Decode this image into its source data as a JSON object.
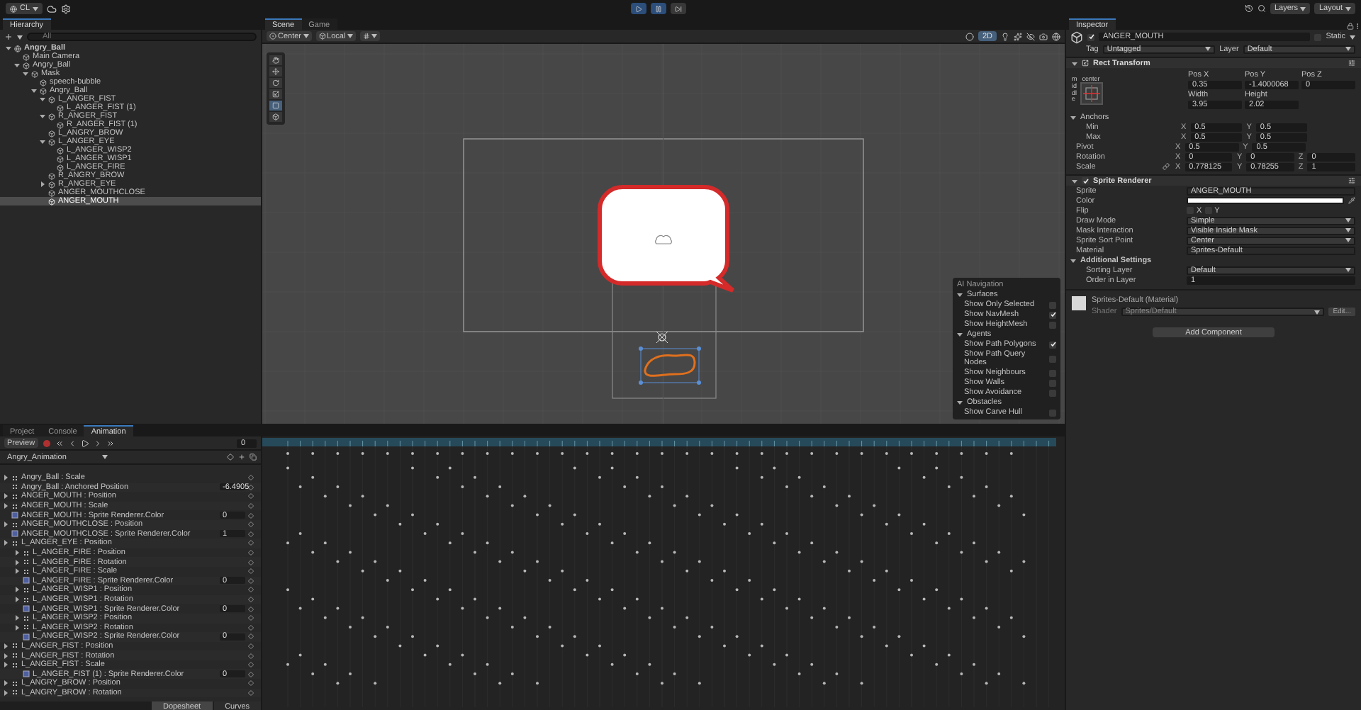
{
  "top_bar": {
    "account": "CL",
    "layers": "Layers",
    "layout": "Layout"
  },
  "hierarchy": {
    "tab": "Hierarchy",
    "search_placeholder": "All",
    "tree": [
      {
        "label": "Angry_Ball",
        "kind": "scene",
        "selected": false,
        "expanded": true,
        "children": [
          {
            "label": "Main Camera",
            "kind": "object",
            "selected": false
          },
          {
            "label": "Angry_Ball",
            "kind": "object",
            "selected": false,
            "expanded": true,
            "children": [
              {
                "label": "Mask",
                "kind": "object",
                "selected": false,
                "expanded": true,
                "children": [
                  {
                    "label": "speech-bubble",
                    "kind": "object",
                    "selected": false
                  },
                  {
                    "label": "Angry_Ball",
                    "kind": "object",
                    "selected": false,
                    "expanded": true,
                    "children": [
                      {
                        "label": "L_ANGER_FIST",
                        "kind": "object",
                        "selected": false,
                        "expanded": true,
                        "children": [
                          {
                            "label": "L_ANGER_FIST (1)",
                            "kind": "object",
                            "selected": false
                          }
                        ]
                      },
                      {
                        "label": "R_ANGER_FIST",
                        "kind": "object",
                        "selected": false,
                        "expanded": true,
                        "children": [
                          {
                            "label": "R_ANGER_FIST (1)",
                            "kind": "object",
                            "selected": false
                          }
                        ]
                      },
                      {
                        "label": "L_ANGRY_BROW",
                        "kind": "object",
                        "selected": false
                      },
                      {
                        "label": "L_ANGER_EYE",
                        "kind": "object",
                        "selected": false,
                        "expanded": true,
                        "children": [
                          {
                            "label": "L_ANGER_WISP2",
                            "kind": "object",
                            "selected": false
                          },
                          {
                            "label": "L_ANGER_WISP1",
                            "kind": "object",
                            "selected": false
                          },
                          {
                            "label": "L_ANGER_FIRE",
                            "kind": "object",
                            "selected": false
                          }
                        ]
                      },
                      {
                        "label": "R_ANGRY_BROW",
                        "kind": "object",
                        "selected": false
                      },
                      {
                        "label": "R_ANGER_EYE",
                        "kind": "object",
                        "selected": false,
                        "expanded": false
                      },
                      {
                        "label": "ANGER_MOUTHCLOSE",
                        "kind": "object",
                        "selected": false
                      },
                      {
                        "label": "ANGER_MOUTH",
                        "kind": "object",
                        "selected": true
                      }
                    ]
                  }
                ]
              }
            ]
          }
        ]
      }
    ]
  },
  "scene": {
    "tabs": [
      {
        "label": "Scene",
        "selected": true
      },
      {
        "label": "Game",
        "selected": false
      }
    ],
    "pivot": "Center",
    "space": "Local",
    "mode_2d": {
      "label": "2D",
      "on": true
    },
    "ai_navigation": {
      "title": "AI Navigation",
      "sections": [
        {
          "label": "Surfaces",
          "expanded": true,
          "items": [
            {
              "label": "Show Only Selected",
              "checked": false
            },
            {
              "label": "Show NavMesh",
              "checked": true
            },
            {
              "label": "Show HeightMesh",
              "checked": false
            }
          ]
        },
        {
          "label": "Agents",
          "expanded": true,
          "items": [
            {
              "label": "Show Path Polygons",
              "checked": true
            },
            {
              "label": "Show Path Query Nodes",
              "checked": false
            },
            {
              "label": "Show Neighbours",
              "checked": false
            },
            {
              "label": "Show Walls",
              "checked": false
            },
            {
              "label": "Show Avoidance",
              "checked": false
            }
          ]
        },
        {
          "label": "Obstacles",
          "expanded": true,
          "items": [
            {
              "label": "Show Carve Hull",
              "checked": false
            }
          ]
        }
      ]
    }
  },
  "inspector": {
    "tab": "Inspector",
    "object_name": "ANGER_MOUTH",
    "active": true,
    "static": false,
    "static_label": "Static",
    "tag_label": "Tag",
    "tag": "Untagged",
    "layer_label": "Layer",
    "layer": "Default",
    "rect_transform": {
      "title": "Rect Transform",
      "anchor_top": "center",
      "anchor_side": "middle",
      "fields": [
        {
          "label": "Pos X",
          "value": "0.35"
        },
        {
          "label": "Pos Y",
          "value": "-1.4000068"
        },
        {
          "label": "Pos Z",
          "value": "0"
        },
        {
          "label": "Width",
          "value": "3.95"
        },
        {
          "label": "Height",
          "value": "2.02"
        }
      ],
      "anchors": {
        "label": "Anchors",
        "expanded": true,
        "children": [
          {
            "label": "Min",
            "axes": [
              {
                "axis": "X",
                "value": "0.5"
              },
              {
                "axis": "Y",
                "value": "0.5"
              }
            ]
          },
          {
            "label": "Max",
            "axes": [
              {
                "axis": "X",
                "value": "0.5"
              },
              {
                "axis": "Y",
                "value": "0.5"
              }
            ]
          }
        ]
      },
      "vectors": [
        {
          "label": "Pivot",
          "linked": false,
          "axes": [
            {
              "axis": "X",
              "value": "0.5"
            },
            {
              "axis": "Y",
              "value": "0.5"
            }
          ]
        },
        {
          "label": "Rotation",
          "linked": false,
          "axes": [
            {
              "axis": "X",
              "value": "0"
            },
            {
              "axis": "Y",
              "value": "0"
            },
            {
              "axis": "Z",
              "value": "0"
            }
          ]
        },
        {
          "label": "Scale",
          "linked": true,
          "axes": [
            {
              "axis": "X",
              "value": "0.778125"
            },
            {
              "axis": "Y",
              "value": "0.78255"
            },
            {
              "axis": "Z",
              "value": "1"
            }
          ]
        }
      ]
    },
    "sprite_renderer": {
      "title": "Sprite Renderer",
      "enabled": true,
      "fields": [
        {
          "label": "Sprite",
          "kind": "object",
          "value": "ANGER_MOUTH"
        },
        {
          "label": "Color",
          "kind": "color",
          "color": "#ffffff"
        },
        {
          "label": "Flip",
          "kind": "flip",
          "options": [
            {
              "label": "X",
              "checked": false
            },
            {
              "label": "Y",
              "checked": false
            }
          ]
        },
        {
          "label": "Draw Mode",
          "kind": "dropdown",
          "value": "Simple"
        },
        {
          "label": "Mask Interaction",
          "kind": "dropdown",
          "value": "Visible Inside Mask"
        },
        {
          "label": "Sprite Sort Point",
          "kind": "dropdown",
          "value": "Center"
        },
        {
          "label": "Material",
          "kind": "object",
          "value": "Sprites-Default"
        }
      ],
      "additional": {
        "label": "Additional Settings",
        "expanded": true,
        "fields": [
          {
            "label": "Sorting Layer",
            "kind": "dropdown",
            "value": "Default"
          },
          {
            "label": "Order in Layer",
            "kind": "number",
            "value": "1"
          }
        ]
      }
    },
    "material": {
      "name": "Sprites-Default (Material)",
      "shader_label": "Shader",
      "shader": "Sprites/Default",
      "edit": "Edit..."
    },
    "add_component": "Add Component"
  },
  "animation": {
    "tabs": [
      {
        "label": "Project",
        "selected": false
      },
      {
        "label": "Console",
        "selected": false
      },
      {
        "label": "Animation",
        "selected": true
      }
    ],
    "preview": "Preview",
    "recording": false,
    "frame": "0",
    "clip": "Angry_Animation",
    "rows": [
      {
        "label": "Angry_Ball : Scale",
        "kind": "transform",
        "expanded": false
      },
      {
        "label": "Angry_Ball : Anchored Position",
        "kind": "transform",
        "value": "-6.4905"
      },
      {
        "label": "ANGER_MOUTH : Position",
        "kind": "transform",
        "expanded": false
      },
      {
        "label": "ANGER_MOUTH : Scale",
        "kind": "transform",
        "expanded": false
      },
      {
        "label": "ANGER_MOUTH : Sprite Renderer.Color",
        "kind": "color",
        "value": "0"
      },
      {
        "label": "ANGER_MOUTHCLOSE : Position",
        "kind": "transform",
        "expanded": false
      },
      {
        "label": "ANGER_MOUTHCLOSE : Sprite Renderer.Color",
        "kind": "color",
        "value": "1"
      },
      {
        "label": "L_ANGER_EYE : Position",
        "kind": "transform",
        "expanded": false,
        "children": [
          {
            "label": "L_ANGER_FIRE : Position",
            "kind": "transform",
            "expanded": false
          },
          {
            "label": "L_ANGER_FIRE : Rotation",
            "kind": "transform",
            "expanded": false
          },
          {
            "label": "L_ANGER_FIRE : Scale",
            "kind": "transform",
            "expanded": false
          },
          {
            "label": "L_ANGER_FIRE : Sprite Renderer.Color",
            "kind": "color",
            "value": "0"
          },
          {
            "label": "L_ANGER_WISP1 : Position",
            "kind": "transform",
            "expanded": false
          },
          {
            "label": "L_ANGER_WISP1 : Rotation",
            "kind": "transform",
            "expanded": false
          },
          {
            "label": "L_ANGER_WISP1 : Sprite Renderer.Color",
            "kind": "color",
            "value": "0"
          },
          {
            "label": "L_ANGER_WISP2 : Position",
            "kind": "transform",
            "expanded": false
          },
          {
            "label": "L_ANGER_WISP2 : Rotation",
            "kind": "transform",
            "expanded": false
          },
          {
            "label": "L_ANGER_WISP2 : Sprite Renderer.Color",
            "kind": "color",
            "value": "0"
          }
        ]
      },
      {
        "label": "L_ANGER_FIST : Position",
        "kind": "transform",
        "expanded": false
      },
      {
        "label": "L_ANGER_FIST : Rotation",
        "kind": "transform",
        "expanded": false
      },
      {
        "label": "L_ANGER_FIST : Scale",
        "kind": "transform",
        "expanded": false,
        "children": [
          {
            "label": "L_ANGER_FIST (1) : Sprite Renderer.Color",
            "kind": "color",
            "value": "0"
          }
        ]
      },
      {
        "label": "L_ANGRY_BROW : Position",
        "kind": "transform",
        "expanded": false
      },
      {
        "label": "L_ANGRY_BROW : Rotation",
        "kind": "transform",
        "expanded": false
      }
    ],
    "views": [
      {
        "label": "Dopesheet",
        "selected": true
      },
      {
        "label": "Curves",
        "selected": false
      }
    ]
  }
}
